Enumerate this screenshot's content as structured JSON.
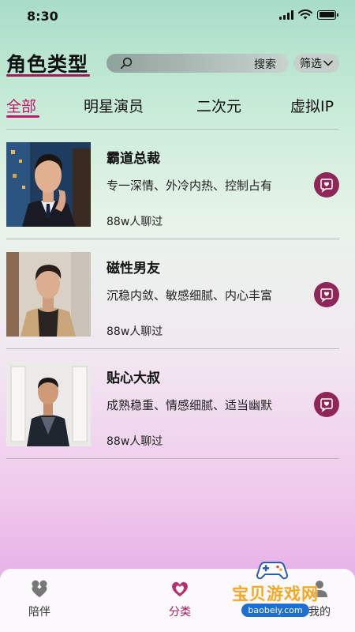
{
  "status_bar": {
    "time": "8:30",
    "icons": [
      "signal-icon",
      "wifi-icon",
      "battery-icon"
    ]
  },
  "header": {
    "title": "角色类型",
    "search": {
      "label": "搜索",
      "icon": "search-icon"
    },
    "filter": {
      "label": "筛选",
      "icon": "chevron-down-icon"
    }
  },
  "tabs": [
    {
      "label": "全部",
      "active": true
    },
    {
      "label": "明星演员",
      "active": false
    },
    {
      "label": "二次元",
      "active": false
    },
    {
      "label": "虚拟IP",
      "active": false
    }
  ],
  "characters": [
    {
      "name": "霸道总裁",
      "tags": "专一深情、外冷内热、控制占有",
      "count": "88w人聊过",
      "action_icon": "chat-icon"
    },
    {
      "name": "磁性男友",
      "tags": "沉稳内敛、敏感细腻、内心丰富",
      "count": "88w人聊过",
      "action_icon": "chat-icon"
    },
    {
      "name": "贴心大叔",
      "tags": "成熟稳重、情感细腻、适当幽默",
      "count": "88w人聊过",
      "action_icon": "chat-icon"
    }
  ],
  "bottom_nav": [
    {
      "label": "陪伴",
      "icon": "companion-icon",
      "active": false
    },
    {
      "label": "分类",
      "icon": "category-heart-icon",
      "active": true
    },
    {
      "label": "我的",
      "icon": "profile-icon",
      "active": false
    }
  ],
  "watermark": {
    "title": "宝贝游戏网",
    "url": "baobeiy.com"
  },
  "colors": {
    "accent": "#c0186b",
    "chat_button": "#8e2657",
    "watermark_orange": "#f6a623",
    "watermark_blue": "#1d6fd1"
  }
}
